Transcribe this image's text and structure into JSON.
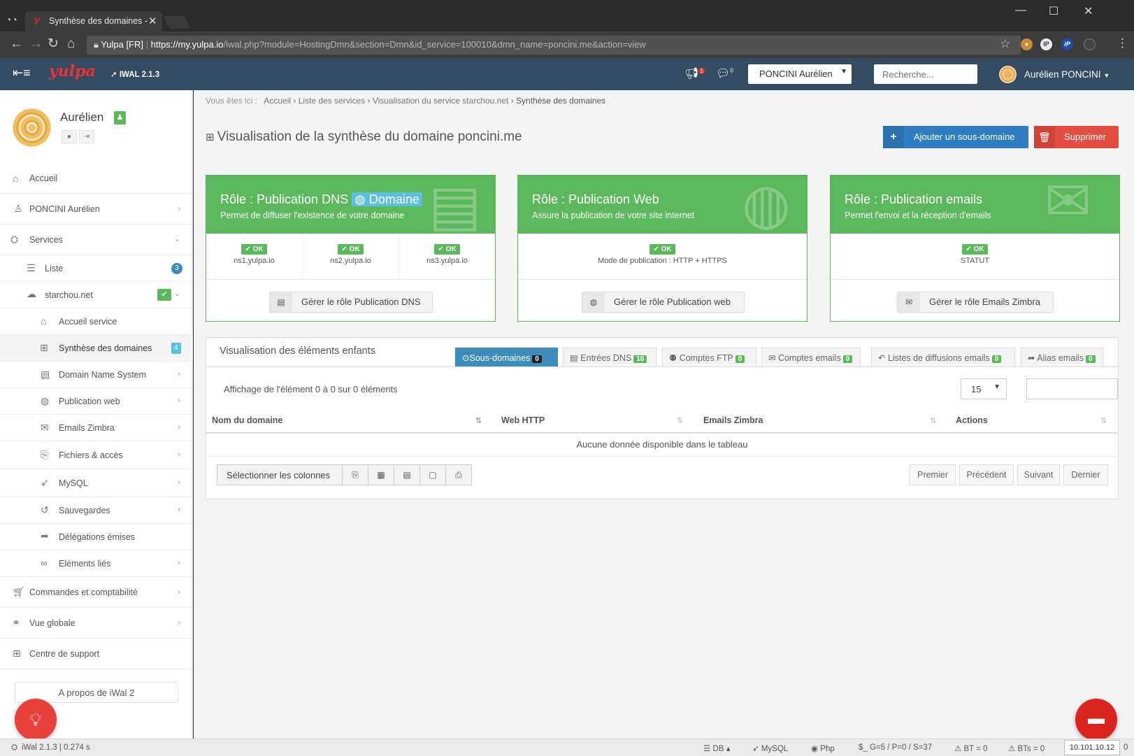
{
  "browser": {
    "tab_title": "Synthèse des domaines -",
    "tab_favicon": "Y",
    "url_secure_label": "Yulpa [FR]",
    "url_scheme": "https://",
    "url_host": "my.yulpa.io",
    "url_path": "/iwal.php?module=HostingDmn&section=Dmn&id_service=100010&dmn_name=poncini.me&action=view",
    "close_glyph": "✕",
    "minimize_glyph": "—",
    "maximize_glyph": "☐",
    "window_close_glyph": "✕",
    "ext_ip_label": "IP",
    "ext_ip2_label": "iP"
  },
  "header": {
    "logo_text": "yulpa",
    "version": "IWAL 2.1.3",
    "notif_badge": "1",
    "chat_badge": "0",
    "user_select": "PONCINI Aurélien",
    "search_placeholder": "Recherche...",
    "user_name": "Aurélien PONCINI"
  },
  "sidebar": {
    "profile_name": "Aurélien",
    "items": [
      {
        "label": "Accueil",
        "icon": "home-icon"
      },
      {
        "label": "PONCINI Aurélien",
        "icon": "person-icon"
      },
      {
        "label": "Services",
        "icon": "cubes-icon"
      },
      {
        "label": "Liste",
        "icon": "list-icon",
        "count": "3"
      },
      {
        "label": "starchou.net",
        "icon": "cloud-icon"
      },
      {
        "label": "Accueil service",
        "icon": "home-icon"
      },
      {
        "label": "Synthèse des domaines",
        "icon": "sitemap-icon",
        "count": "4"
      },
      {
        "label": "Domain Name System",
        "icon": "book-icon"
      },
      {
        "label": "Publication web",
        "icon": "globe-icon"
      },
      {
        "label": "Emails Zimbra",
        "icon": "envelope-icon"
      },
      {
        "label": "Fichiers & accès",
        "icon": "files-icon"
      },
      {
        "label": "MySQL",
        "icon": "dolphin-icon"
      },
      {
        "label": "Sauvegardes",
        "icon": "backup-icon"
      },
      {
        "label": "Délégations émises",
        "icon": "share-icon"
      },
      {
        "label": "Eléments liés",
        "icon": "link-icon"
      },
      {
        "label": "Commandes et comptabilité",
        "icon": "cart-icon"
      },
      {
        "label": "Vue globale",
        "icon": "binoculars-icon"
      },
      {
        "label": "Centre de support",
        "icon": "medkit-icon"
      }
    ],
    "about": "A propos de iWal 2"
  },
  "breadcrumb": {
    "prefix": "Vous êtes ici :",
    "items": [
      "Accueil",
      "Liste des services",
      "Visualisation du service starchou.net",
      "Synthèse des domaines"
    ]
  },
  "page": {
    "title": "Visualisation de la synthèse du domaine poncini.me",
    "add_subdomain": "Ajouter un sous-domaine",
    "delete": "Supprimer"
  },
  "roles": [
    {
      "title": "Rôle : Publication DNS",
      "tag": "Domaine",
      "subtitle": "Permet de diffuser l'existence de votre domaine",
      "checks": [
        {
          "status": "OK",
          "label": "ns1.yulpa.io"
        },
        {
          "status": "OK",
          "label": "ns2.yulpa.io"
        },
        {
          "status": "OK",
          "label": "ns3.yulpa.io"
        }
      ],
      "button": "Gérer le rôle Publication DNS"
    },
    {
      "title": "Rôle : Publication Web",
      "subtitle": "Assure la publication de votre site internet",
      "checks": [
        {
          "status": "OK",
          "label": "Mode de publication : HTTP + HTTPS"
        }
      ],
      "button": "Gérer le rôle Publication web"
    },
    {
      "title": "Rôle : Publication emails",
      "subtitle": "Permet l'envoi et la réception d'emails",
      "checks": [
        {
          "status": "OK",
          "label": "STATUT"
        }
      ],
      "button": "Gérer le rôle Emails Zimbra"
    }
  ],
  "children": {
    "title": "Visualisation des éléments enfants",
    "tabs": [
      {
        "label": "Sous-domaines",
        "count": "0",
        "active": true
      },
      {
        "label": "Entrées DNS",
        "count": "10"
      },
      {
        "label": "Comptes FTP",
        "count": "0"
      },
      {
        "label": "Comptes emails",
        "count": "0"
      },
      {
        "label": "Listes de diffusions emails",
        "count": "0"
      },
      {
        "label": "Alias emails",
        "count": "0"
      }
    ],
    "showing": "Affichage de l'élément 0 à 0 sur 0 éléments",
    "page_size": "15",
    "columns": [
      "Nom du domaine",
      "Web HTTP",
      "Emails Zimbra",
      "Actions"
    ],
    "empty": "Aucune donnée disponible dans le tableau",
    "select_columns": "Sélectionner les colonnes",
    "pagination": [
      "Premier",
      "Précédent",
      "Suivant",
      "Dernier"
    ]
  },
  "footer": {
    "version": "iWal 2.1.3 | 0.274 s",
    "db": "DB",
    "mysql": "MySQL",
    "php": "Php",
    "globals": "$_ G=5 / P=0 / S=37",
    "bt": "BT = 0",
    "bts": "BTs = 0",
    "ip": "10.101.10.12",
    "trail": "0"
  },
  "colors": {
    "header_bg": "#344b62",
    "role_green": "#5cb85c",
    "primary_blue": "#2f7ec1",
    "danger_red": "#e24f42",
    "tab_active": "#3c8dbc"
  }
}
